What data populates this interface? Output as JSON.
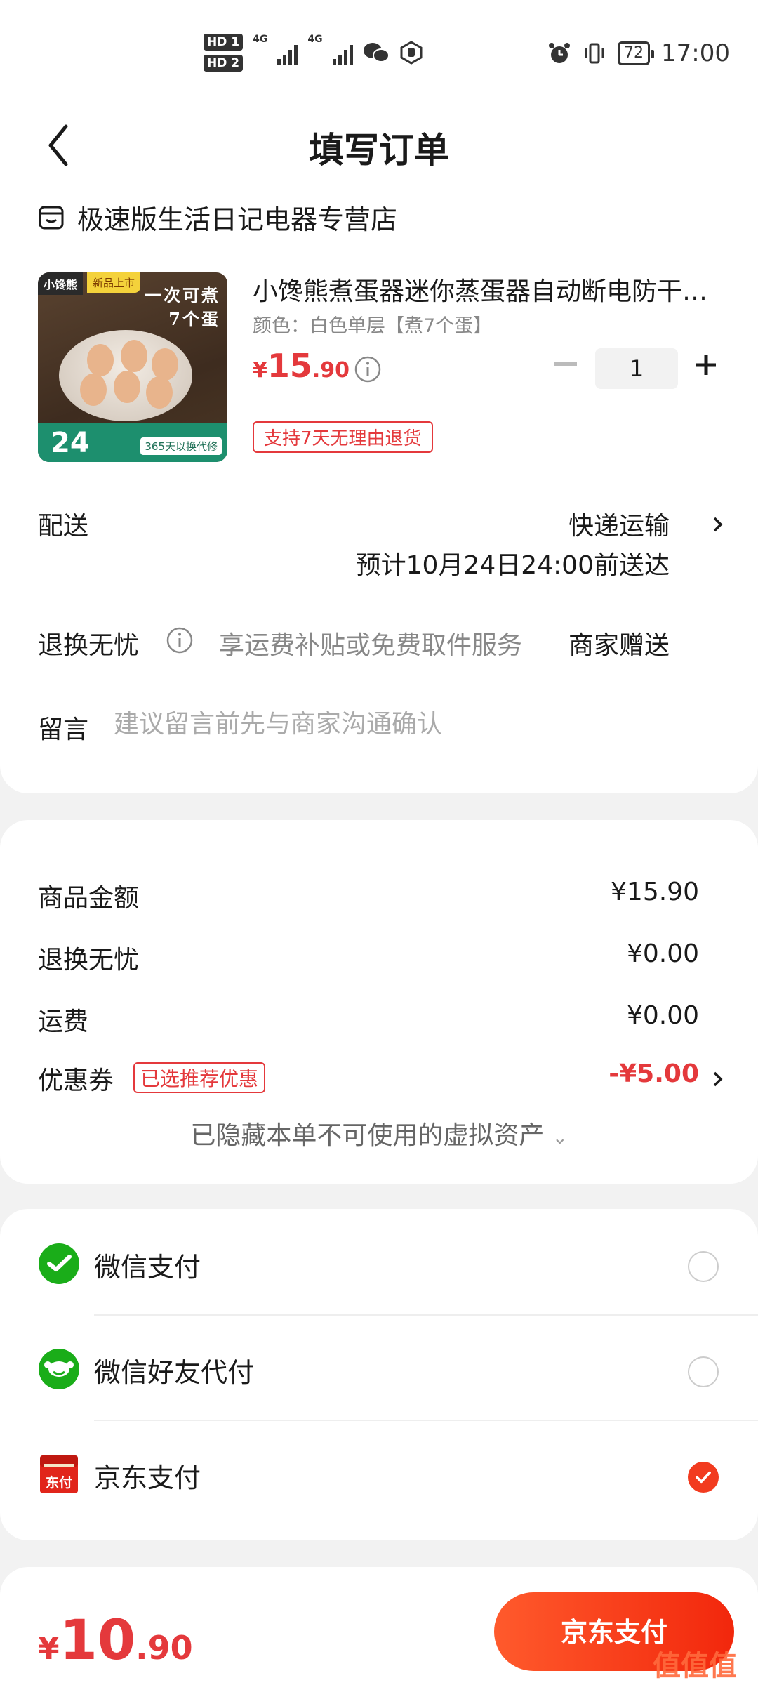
{
  "status_bar": {
    "hd1": "HD 1",
    "hd2": "HD 2",
    "net1": "4G",
    "net2": "4G",
    "battery": "72",
    "time": "17:00"
  },
  "header": {
    "title": "填写订单"
  },
  "store": {
    "name": "极速版生活日记电器专营店"
  },
  "product": {
    "image": {
      "brand": "小馋熊",
      "badge": "新品上市",
      "slogan_line1": "一次可煮",
      "slogan_line2": "7个蛋",
      "promo_price": "24",
      "warranty": "365天以换代修"
    },
    "title": "小馋熊煮蛋器迷你蒸蛋器自动断电防干烧家用",
    "variant": "颜色：白色单层【煮7个蛋】",
    "price_currency": "¥",
    "price_int": "15",
    "price_dec": ".90",
    "quantity": "1",
    "return_tag": "支持7天无理由退货"
  },
  "delivery": {
    "label": "配送",
    "method": "快递运输",
    "eta": "预计10月24日24:00前送达"
  },
  "return_service": {
    "label": "退换无忧",
    "desc": "享运费补贴或免费取件服务",
    "value": "商家赠送"
  },
  "memo": {
    "label": "留言",
    "placeholder": "建议留言前先与商家沟通确认"
  },
  "summary": {
    "goods_label": "商品金额",
    "goods_value": "¥15.90",
    "return_label": "退换无忧",
    "return_value": "¥0.00",
    "shipping_label": "运费",
    "shipping_value": "¥0.00",
    "coupon_label": "优惠券",
    "coupon_tag": "已选推荐优惠",
    "coupon_value": "-¥5.00",
    "hidden_assets": "已隐藏本单不可使用的虚拟资产"
  },
  "payment_methods": [
    {
      "label": "微信支付",
      "icon": "wechat-pay-icon",
      "selected": false
    },
    {
      "label": "微信好友代付",
      "icon": "wechat-friend-pay-icon",
      "selected": false
    },
    {
      "label": "京东支付",
      "icon": "jd-pay-icon",
      "icon_text": "东付",
      "selected": true
    }
  ],
  "footer": {
    "total_currency": "¥",
    "total_int": "10",
    "total_dec": ".90",
    "pay_button": "京东支付"
  },
  "watermark": "值值值",
  "colors": {
    "accent_red": "#e4393c",
    "pay_button": "#f2270c",
    "wechat_green": "#1aad19",
    "jd_red": "#e1251b"
  }
}
